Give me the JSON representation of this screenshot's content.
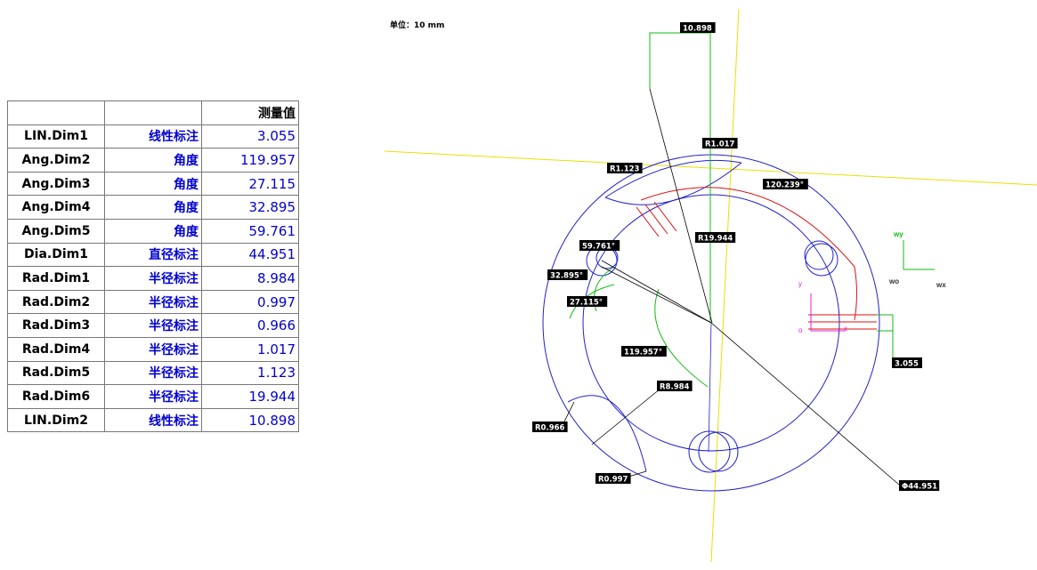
{
  "unit_label": "单位：10 mm",
  "table": {
    "header": [
      "",
      "",
      "测量值"
    ],
    "rows": [
      {
        "name": "LIN.Dim1",
        "type": "线性标注",
        "value": "3.055"
      },
      {
        "name": "Ang.Dim2",
        "type": "角度",
        "value": "119.957"
      },
      {
        "name": "Ang.Dim3",
        "type": "角度",
        "value": "27.115"
      },
      {
        "name": "Ang.Dim4",
        "type": "角度",
        "value": "32.895"
      },
      {
        "name": "Ang.Dim5",
        "type": "角度",
        "value": "59.761"
      },
      {
        "name": "Dia.Dim1",
        "type": "直径标注",
        "value": "44.951"
      },
      {
        "name": "Rad.Dim1",
        "type": "半径标注",
        "value": "8.984"
      },
      {
        "name": "Rad.Dim2",
        "type": "半径标注",
        "value": "0.997"
      },
      {
        "name": "Rad.Dim3",
        "type": "半径标注",
        "value": "0.966"
      },
      {
        "name": "Rad.Dim4",
        "type": "半径标注",
        "value": "1.017"
      },
      {
        "name": "Rad.Dim5",
        "type": "半径标注",
        "value": "1.123"
      },
      {
        "name": "Rad.Dim6",
        "type": "半径标注",
        "value": "19.944"
      },
      {
        "name": "LIN.Dim2",
        "type": "线性标注",
        "value": "10.898"
      }
    ]
  },
  "drawing_labels": {
    "lin2": "10.898",
    "r1017": "R1.017",
    "r1123": "R1.123",
    "a120": "120.239°",
    "r19944": "R19.944",
    "a59": "59.761°",
    "a32": "32.895°",
    "a27": "27.115°",
    "a119": "119.957°",
    "r8984": "R8.984",
    "r0966": "R0.966",
    "r0997": "R0.997",
    "lin1": "3.055",
    "dia": "Φ44.951"
  },
  "axes_labels": {
    "wy": "wy",
    "wo": "wo",
    "wx": "wx",
    "y": "y",
    "o": "o",
    "x": "x"
  },
  "colors": {
    "circle": "#2222cc",
    "dimension_red": "#dd1111",
    "dimension_green": "#11bb11",
    "axis_yellow": "#e8e000",
    "leader": "#000000",
    "magenta": "#e020e0"
  }
}
